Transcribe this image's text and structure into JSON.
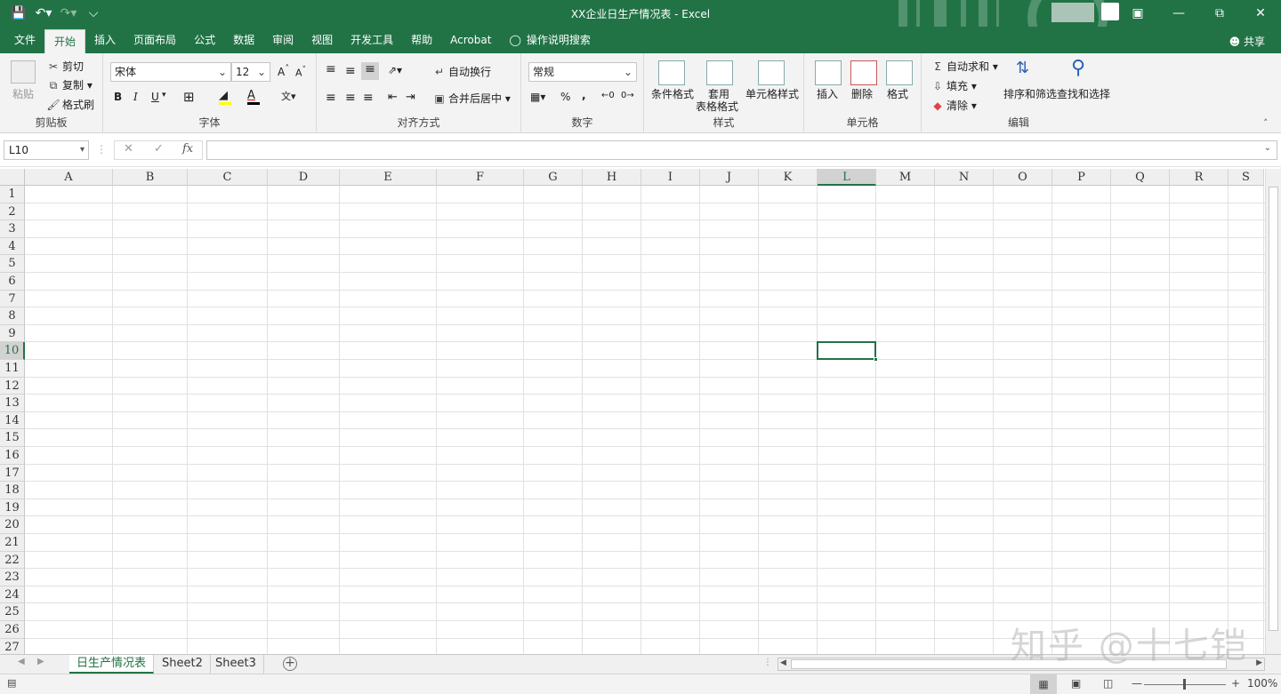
{
  "window": {
    "title": "XX企业日生产情况表 - Excel",
    "accent": "#217346"
  },
  "qat": {
    "save": "save-icon",
    "undo": "undo-icon",
    "redo": "redo-icon",
    "customize": "customize-icon"
  },
  "tabs": {
    "items": [
      "文件",
      "开始",
      "插入",
      "页面布局",
      "公式",
      "数据",
      "审阅",
      "视图",
      "开发工具",
      "帮助",
      "Acrobat"
    ],
    "active": "开始",
    "tellme": "操作说明搜索",
    "share": "共享"
  },
  "ribbon": {
    "clipboard": {
      "paste": "粘贴",
      "cut": "剪切",
      "copy": "复制",
      "painter": "格式刷",
      "label": "剪贴板"
    },
    "font": {
      "name": "宋体",
      "size": "12",
      "label": "字体",
      "bold": "B",
      "italic": "I",
      "underline": "U",
      "grow": "A",
      "shrink": "A"
    },
    "align": {
      "wrap": "自动换行",
      "merge": "合并后居中",
      "label": "对齐方式"
    },
    "number": {
      "format": "常规",
      "percent": "%",
      "comma": ",",
      "label": "数字"
    },
    "styles": {
      "cond": "条件格式",
      "table1": "套用",
      "table2": "表格格式",
      "cell": "单元格样式",
      "label": "样式"
    },
    "cells": {
      "insert": "插入",
      "delete": "删除",
      "format": "格式",
      "label": "单元格"
    },
    "editing": {
      "autosum": "自动求和",
      "fill": "填充",
      "clear": "清除",
      "sort": "排序和筛选",
      "find": "查找和选择",
      "label": "编辑"
    }
  },
  "formula": {
    "namebox": "L10",
    "cancel": "✕",
    "enter": "✓",
    "fx": "fx",
    "value": ""
  },
  "sheet": {
    "columns": [
      "A",
      "B",
      "C",
      "D",
      "E",
      "F",
      "G",
      "H",
      "I",
      "J",
      "K",
      "L",
      "M",
      "N",
      "O",
      "P",
      "Q",
      "R",
      "S"
    ],
    "rows": [
      "1",
      "2",
      "3",
      "4",
      "5",
      "6",
      "7",
      "8",
      "9",
      "10",
      "11",
      "12",
      "13",
      "14",
      "15",
      "16",
      "17",
      "18",
      "19",
      "20",
      "21",
      "22",
      "23",
      "24",
      "25",
      "26",
      "27"
    ],
    "selected_col": "L",
    "selected_row": "10"
  },
  "sheettabs": {
    "tabs": [
      "日生产情况表",
      "Sheet2",
      "Sheet3"
    ],
    "active": "日生产情况表"
  },
  "status": {
    "zoom": "100%"
  },
  "watermark": "知乎 @十七铠"
}
